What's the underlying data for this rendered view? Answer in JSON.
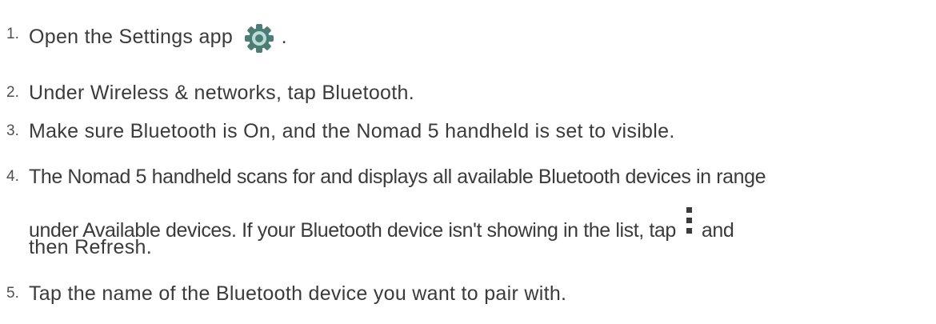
{
  "steps": [
    {
      "num": "1.",
      "text": "Open the Settings app",
      "suffix": "."
    },
    {
      "num": "2.",
      "text": "Under Wireless & networks, tap Bluetooth."
    },
    {
      "num": "3.",
      "text": "Make sure Bluetooth is On, and the Nomad 5 handheld is set to visible."
    },
    {
      "num": "4.",
      "line1": "The Nomad 5 handheld scans for and displays all available Bluetooth devices in range",
      "line2_prefix": "under Available devices. If your Bluetooth device isn't showing in the list, tap",
      "line2_suffix": "and",
      "line3": "then Refresh."
    },
    {
      "num": "5.",
      "text": "Tap the name of the Bluetooth device you want to pair with."
    }
  ],
  "icons": {
    "settings": "settings-gear-icon",
    "overflow": "overflow-menu-icon"
  },
  "colors": {
    "text": "#3b3b3b",
    "gear_dark": "#4e7d78",
    "gear_light": "#b9ddd9"
  }
}
